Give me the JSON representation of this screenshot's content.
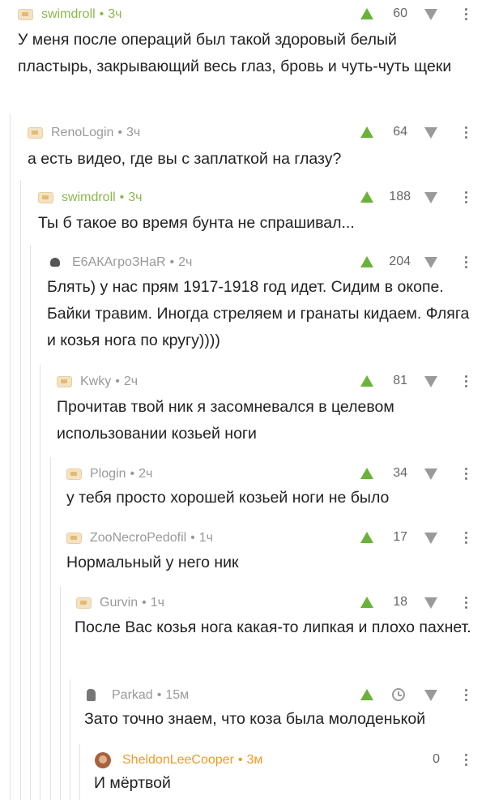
{
  "comments": [
    {
      "author": "swimdroll",
      "time": "3ч",
      "score": "60",
      "text": "У меня после операций был такой здоровый белый пластырь, закрывающий весь глаз, бровь и чуть-чуть щеки"
    },
    {
      "author": "RenoLogin",
      "time": "3ч",
      "score": "64",
      "text": "а есть видео, где вы с заплаткой на глазу?"
    },
    {
      "author": "swimdroll",
      "time": "3ч",
      "score": "188",
      "text": "Ты б такое во время бунта не спрашивал..."
    },
    {
      "author": "Е6АКАгроЗНаR",
      "time": "2ч",
      "score": "204",
      "text": "Блять) у нас прям 1917-1918 год идет. Сидим в окопе. Байки травим. Иногда стреляем и гранаты кидаем. Фляга и козья нога по кругу))))"
    },
    {
      "author": "Kwky",
      "time": "2ч",
      "score": "81",
      "text": "Прочитав твой ник я засомневался в целевом использовании козьей ноги"
    },
    {
      "author": "Plogin",
      "time": "2ч",
      "score": "34",
      "text": "у тебя просто хорошей козьей ноги не было"
    },
    {
      "author": "ZooNecroPedofil",
      "time": "1ч",
      "score": "17",
      "text": "Нормальный у него ник"
    },
    {
      "author": "Gurvin",
      "time": "1ч",
      "score": "18",
      "text": "После Вас козья нога какая-то липкая и плохо пахнет."
    },
    {
      "author": "Parkad",
      "time": "15м",
      "score": "",
      "text": "Зато точно знаем, что коза была молоденькой"
    },
    {
      "author": "SheldonLeeCooper",
      "time": "3м",
      "score": "0",
      "text": "И мёртвой"
    }
  ],
  "icons": {
    "upvote": "arrow-up-icon",
    "downvote": "arrow-down-icon",
    "more": "kebab-menu-icon",
    "save": "clock-icon"
  },
  "colors": {
    "upvote": "#6ab23a",
    "author_highlight": "#8ab84e",
    "author_new": "#f09a24"
  }
}
